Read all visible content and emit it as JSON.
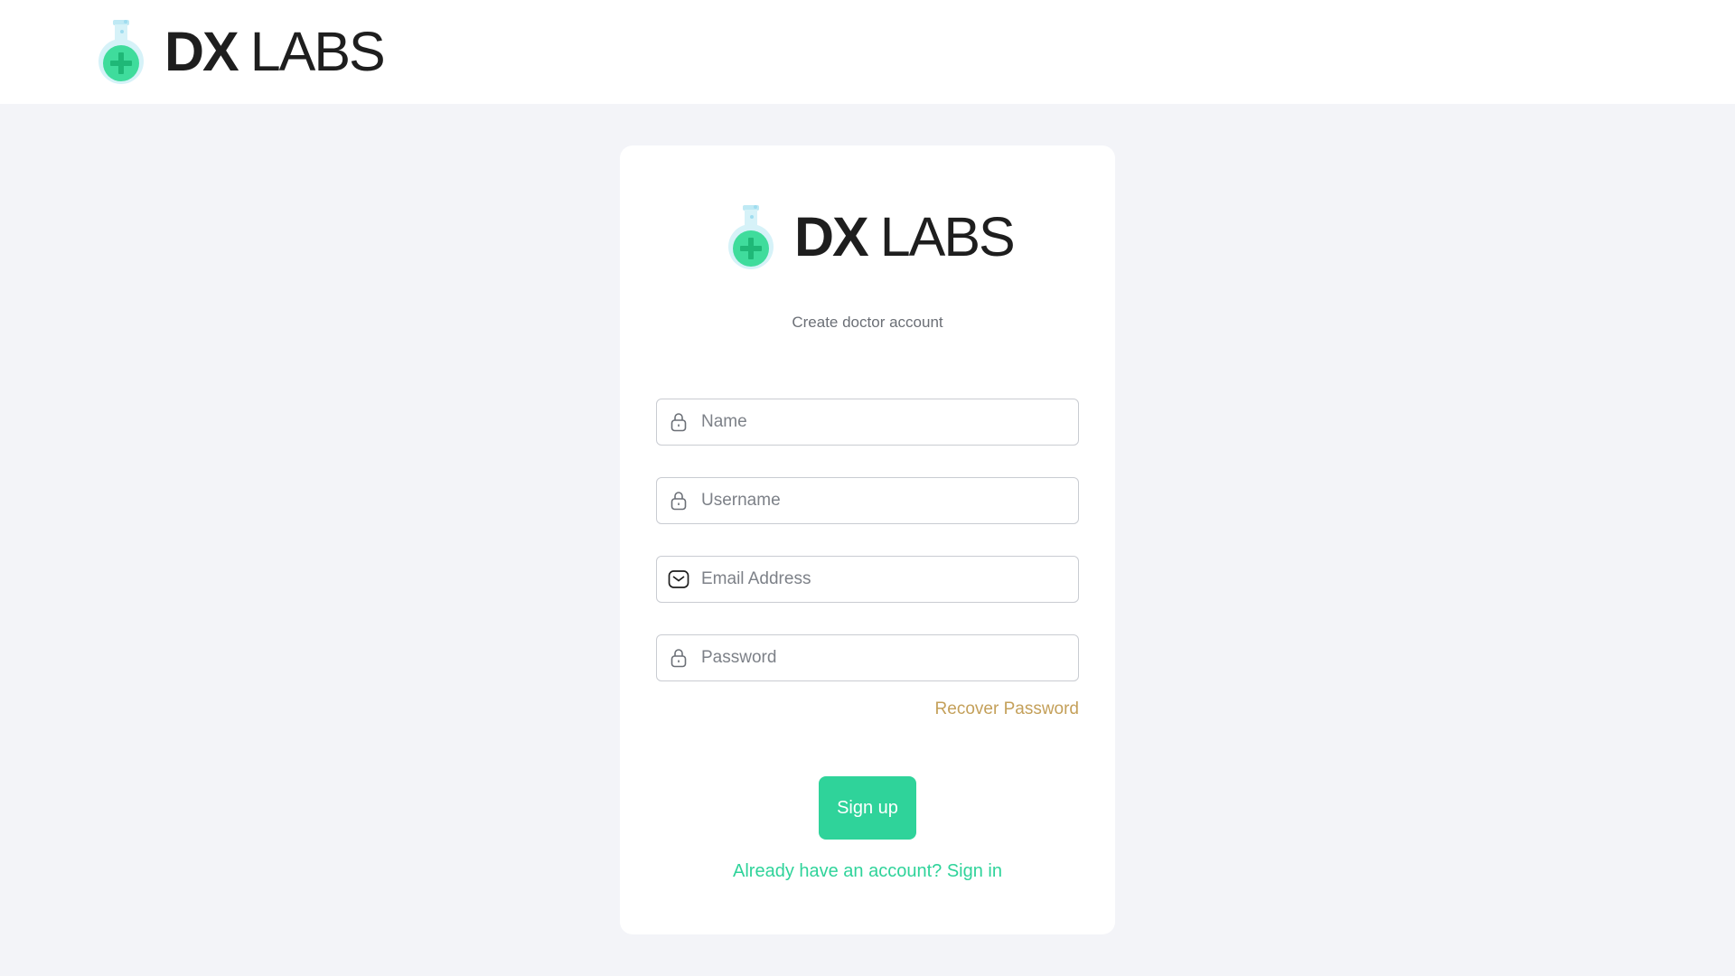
{
  "brand": {
    "bold": "DX",
    "light": "LABS"
  },
  "card": {
    "subtitle": "Create doctor account"
  },
  "form": {
    "name_placeholder": "Name",
    "username_placeholder": "Username",
    "email_placeholder": "Email Address",
    "password_placeholder": "Password",
    "name_icon": "lock-icon",
    "username_icon": "lock-icon",
    "email_icon": "envelope-icon",
    "password_icon": "lock-icon"
  },
  "links": {
    "recover_password": "Recover Password",
    "sign_in": "Already have an account? Sign in"
  },
  "buttons": {
    "sign_up": "Sign up"
  },
  "colors": {
    "accent_green": "#2fd39a",
    "recover_gold": "#c4a05a",
    "page_background": "#f3f4f8",
    "brand_text": "#1e1e1e"
  }
}
